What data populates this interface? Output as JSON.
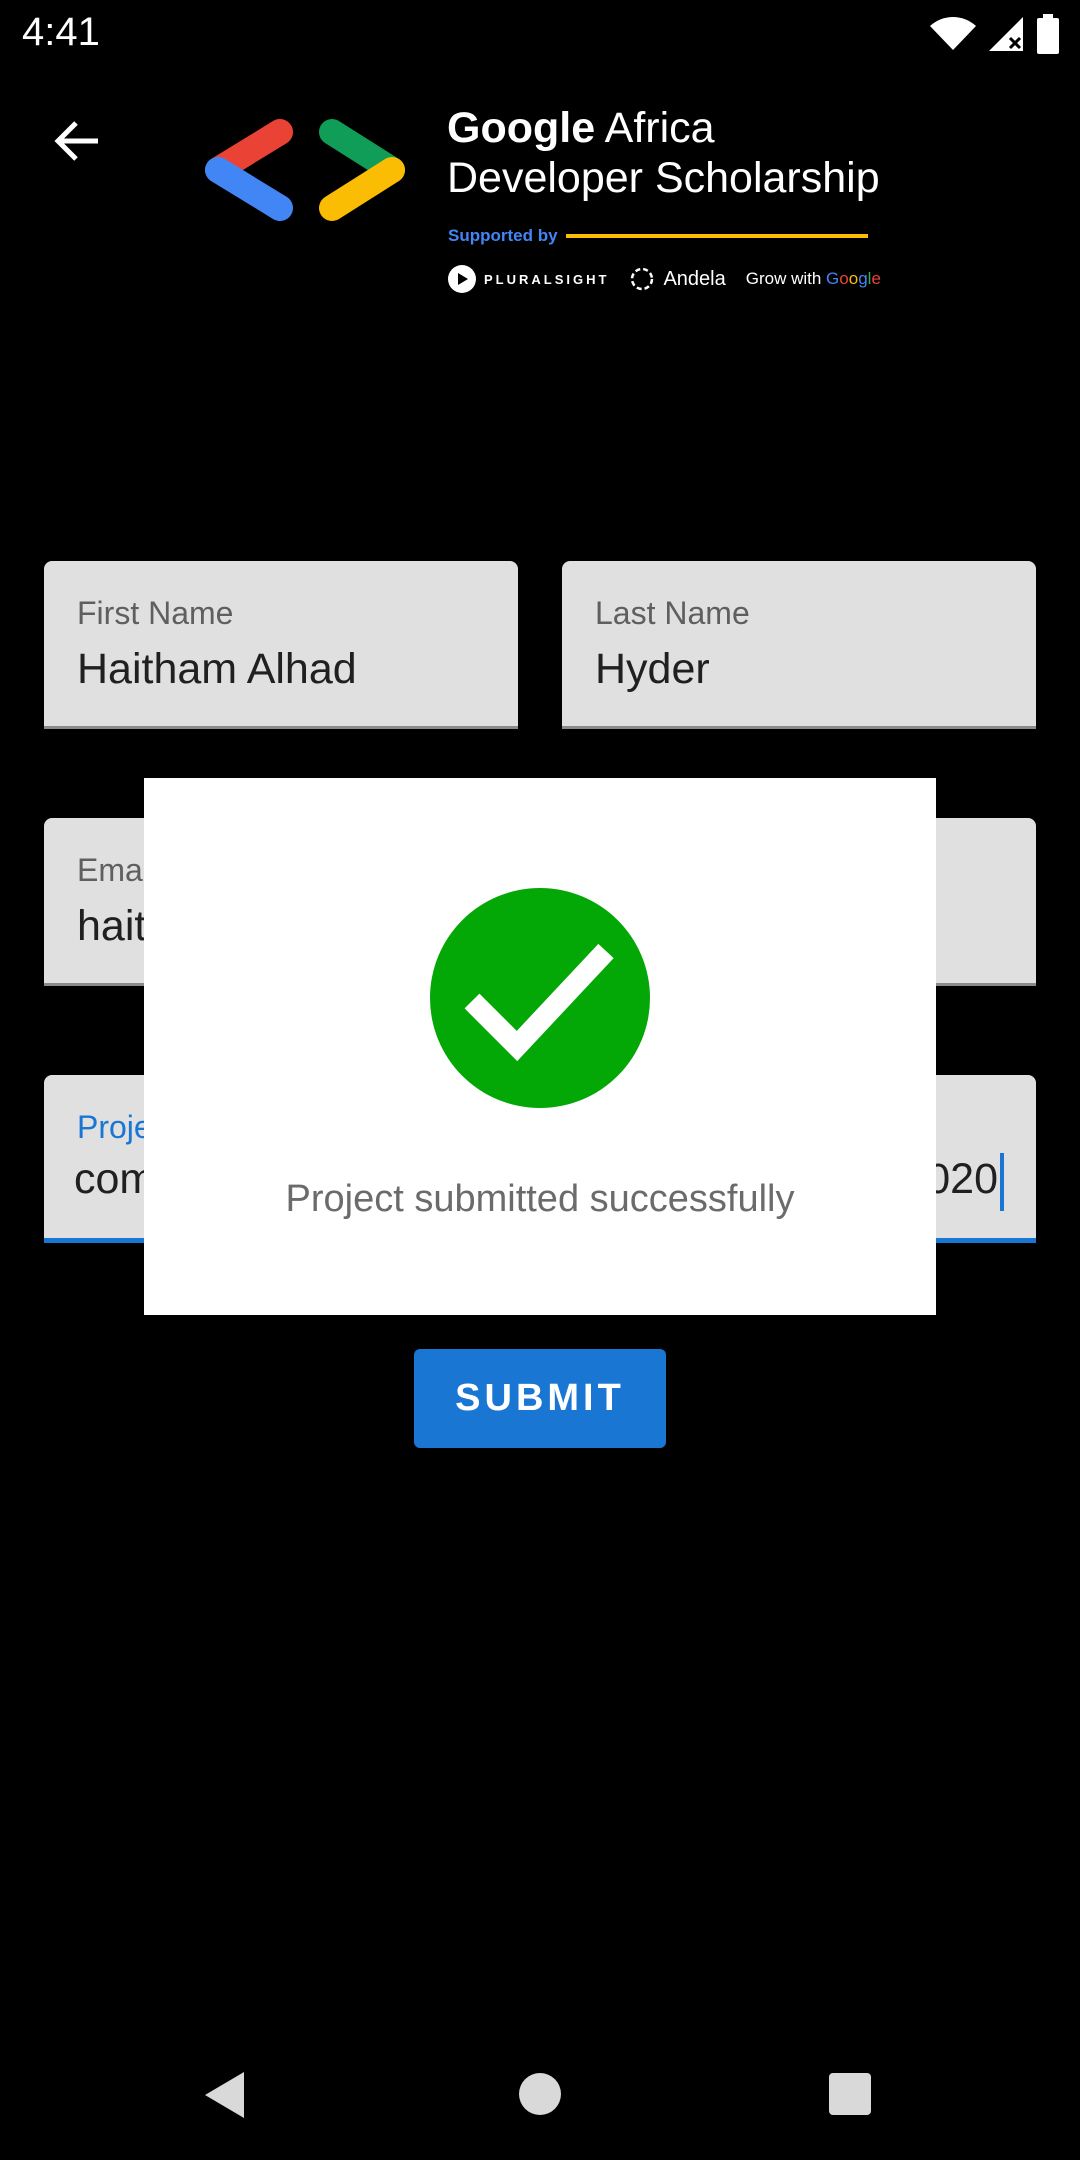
{
  "status_bar": {
    "time": "4:41",
    "icons": [
      "wifi-icon",
      "signal-icon",
      "battery-icon"
    ]
  },
  "header": {
    "back_icon": "arrow-left-icon",
    "logo_line1_bold": "Google",
    "logo_line1_rest": " Africa",
    "logo_line2": "Developer Scholarship",
    "supported_by": "Supported by",
    "sponsors": {
      "pluralsight": "PLURALSIGHT",
      "andela": "Andela",
      "grow_prefix": "Grow with ",
      "grow_google": [
        "G",
        "o",
        "o",
        "g",
        "l",
        "e"
      ]
    }
  },
  "form": {
    "first_name": {
      "label": "First Name",
      "value": "Haitham Alhad"
    },
    "last_name": {
      "label": "Last Name",
      "value": "Hyder"
    },
    "email": {
      "label": "Ema",
      "value": "hait"
    },
    "project": {
      "label": "Proje",
      "value_left": "com",
      "value_right": "020"
    },
    "submit_label": "SUBMIT"
  },
  "dialog": {
    "icon": "check-circle-icon",
    "message": "Project submitted successfully"
  },
  "colors": {
    "accent": "#1976d2",
    "success": "#03a706",
    "field_bg": "#e0e0e0"
  },
  "nav_bar": {
    "icons": [
      "nav-back-icon",
      "nav-home-icon",
      "nav-recents-icon"
    ]
  }
}
